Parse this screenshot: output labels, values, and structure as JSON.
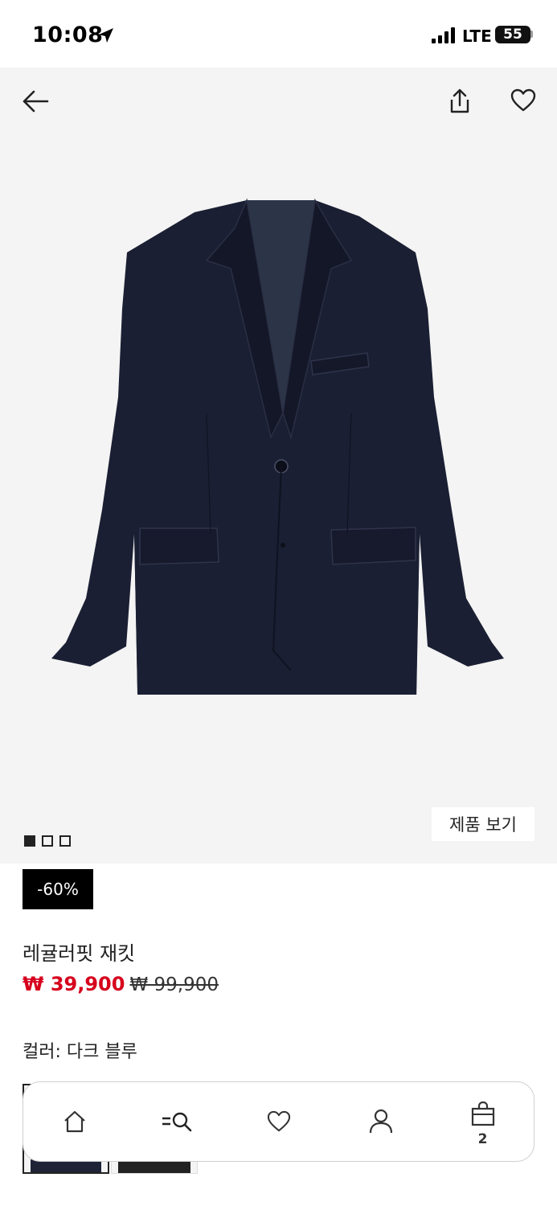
{
  "status_bar": {
    "time": "10:08",
    "network": "LTE",
    "battery": "55"
  },
  "gallery": {
    "view_product_label": "제품 보기",
    "image_count": 3,
    "active_index": 0
  },
  "product": {
    "discount_badge": "-60%",
    "name": "레귤러핏 재킷",
    "sale_price": "₩ 39,900",
    "original_price": "₩ 99,900",
    "color_label": "컬러: 다크 블루"
  },
  "bottom_nav": {
    "cart_count": "2"
  },
  "colors": {
    "sale_red": "#d6001c",
    "jacket_navy": "#1b1f33",
    "swatch_navy": "#1e2436",
    "swatch_black": "#222222"
  }
}
